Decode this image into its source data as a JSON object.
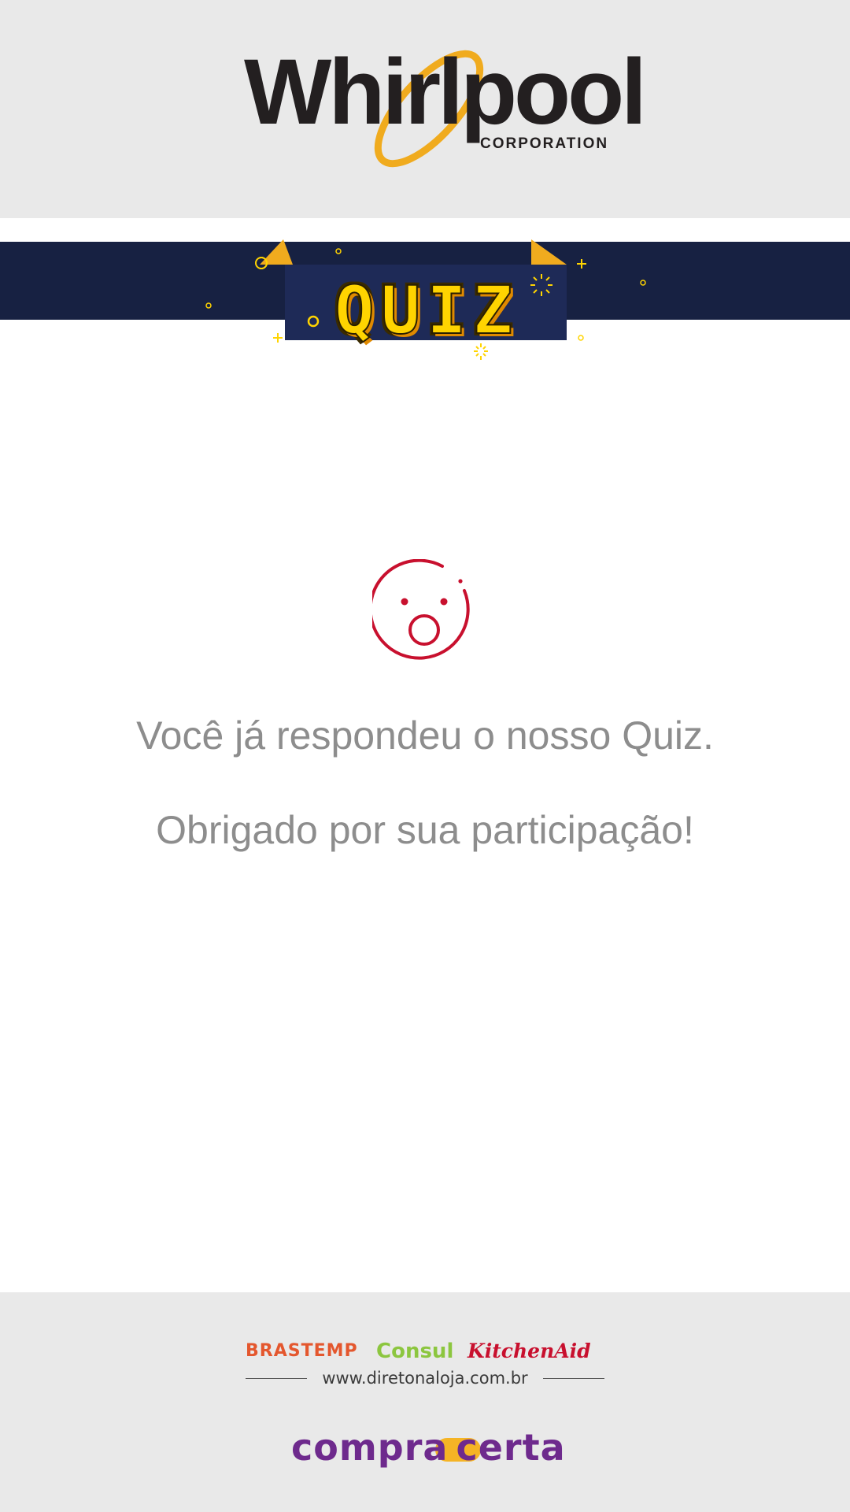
{
  "header": {
    "logo_wordmark": "Whirlpool",
    "logo_subtitle": "CORPORATION"
  },
  "banner": {
    "badge_text": "QUIZ"
  },
  "main": {
    "icon": "surprised-face-icon",
    "message_line1": "Você já respondeu o nosso Quiz.",
    "message_line2": "Obrigado por sua participação!"
  },
  "footer": {
    "brands": [
      "BRASTEMP",
      "Consul",
      "KitchenAid"
    ],
    "website": "www.diretonaloja.com.br",
    "compra_certa_left": "compra",
    "compra_certa_right": "certa"
  },
  "colors": {
    "header_bg": "#e9e9e9",
    "banner_navy": "#172142",
    "quiz_yellow": "#ffd400",
    "face_red": "#c8102e",
    "message_gray": "#8d8d8d",
    "whirlpool_ring": "#f0ab1e",
    "compra_certa_purple": "#6e2a8d",
    "compra_certa_pill": "#f5b425"
  }
}
